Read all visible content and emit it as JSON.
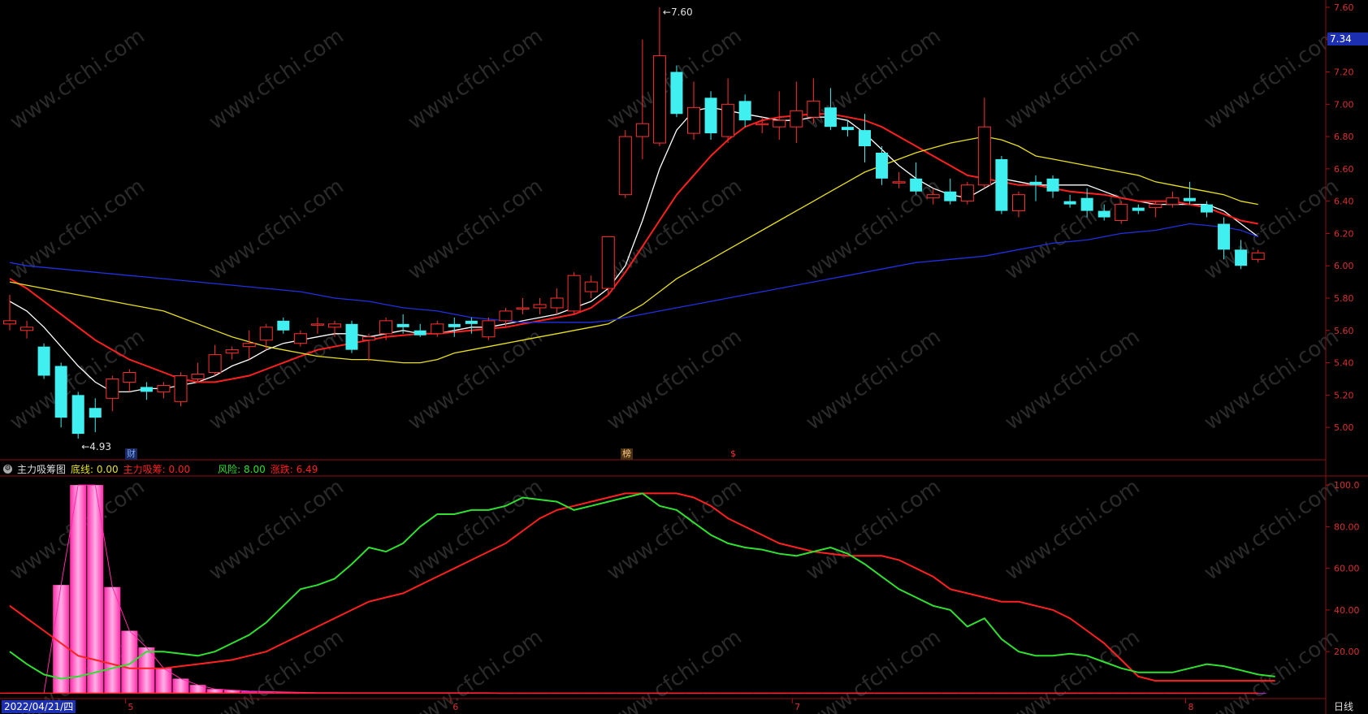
{
  "chart_data": [
    {
      "type": "candlestick",
      "panel": "price",
      "y_ticks": [
        "7.60",
        "7.40",
        "7.20",
        "7.00",
        "6.80",
        "6.60",
        "6.40",
        "6.20",
        "6.00",
        "5.80",
        "5.60",
        "5.40",
        "5.20",
        "5.00"
      ],
      "ylim": [
        4.88,
        7.62
      ],
      "high_label": "7.60",
      "low_label": "4.93",
      "last_price": "7.34",
      "candles": [
        {
          "o": 5.64,
          "h": 5.82,
          "l": 5.6,
          "c": 5.66
        },
        {
          "o": 5.6,
          "h": 5.66,
          "l": 5.55,
          "c": 5.62
        },
        {
          "o": 5.5,
          "h": 5.52,
          "l": 5.3,
          "c": 5.32
        },
        {
          "o": 5.38,
          "h": 5.4,
          "l": 5.0,
          "c": 5.06
        },
        {
          "o": 5.2,
          "h": 5.22,
          "l": 4.93,
          "c": 4.96
        },
        {
          "o": 5.12,
          "h": 5.18,
          "l": 4.97,
          "c": 5.06
        },
        {
          "o": 5.18,
          "h": 5.32,
          "l": 5.1,
          "c": 5.3
        },
        {
          "o": 5.28,
          "h": 5.36,
          "l": 5.22,
          "c": 5.34
        },
        {
          "o": 5.25,
          "h": 5.28,
          "l": 5.17,
          "c": 5.22
        },
        {
          "o": 5.22,
          "h": 5.28,
          "l": 5.18,
          "c": 5.26
        },
        {
          "o": 5.16,
          "h": 5.34,
          "l": 5.13,
          "c": 5.32
        },
        {
          "o": 5.3,
          "h": 5.4,
          "l": 5.28,
          "c": 5.33
        },
        {
          "o": 5.34,
          "h": 5.51,
          "l": 5.32,
          "c": 5.45
        },
        {
          "o": 5.46,
          "h": 5.5,
          "l": 5.42,
          "c": 5.48
        },
        {
          "o": 5.5,
          "h": 5.6,
          "l": 5.42,
          "c": 5.52
        },
        {
          "o": 5.54,
          "h": 5.64,
          "l": 5.48,
          "c": 5.62
        },
        {
          "o": 5.66,
          "h": 5.68,
          "l": 5.58,
          "c": 5.6
        },
        {
          "o": 5.52,
          "h": 5.6,
          "l": 5.5,
          "c": 5.58
        },
        {
          "o": 5.64,
          "h": 5.68,
          "l": 5.58,
          "c": 5.64
        },
        {
          "o": 5.62,
          "h": 5.66,
          "l": 5.56,
          "c": 5.64
        },
        {
          "o": 5.64,
          "h": 5.66,
          "l": 5.46,
          "c": 5.48
        },
        {
          "o": 5.54,
          "h": 5.58,
          "l": 5.41,
          "c": 5.56
        },
        {
          "o": 5.58,
          "h": 5.68,
          "l": 5.54,
          "c": 5.66
        },
        {
          "o": 5.64,
          "h": 5.7,
          "l": 5.58,
          "c": 5.62
        },
        {
          "o": 5.6,
          "h": 5.64,
          "l": 5.56,
          "c": 5.57
        },
        {
          "o": 5.58,
          "h": 5.66,
          "l": 5.56,
          "c": 5.64
        },
        {
          "o": 5.64,
          "h": 5.68,
          "l": 5.56,
          "c": 5.62
        },
        {
          "o": 5.66,
          "h": 5.68,
          "l": 5.58,
          "c": 5.64
        },
        {
          "o": 5.56,
          "h": 5.68,
          "l": 5.54,
          "c": 5.66
        },
        {
          "o": 5.66,
          "h": 5.74,
          "l": 5.62,
          "c": 5.72
        },
        {
          "o": 5.74,
          "h": 5.8,
          "l": 5.7,
          "c": 5.74
        },
        {
          "o": 5.74,
          "h": 5.8,
          "l": 5.7,
          "c": 5.76
        },
        {
          "o": 5.74,
          "h": 5.86,
          "l": 5.7,
          "c": 5.8
        },
        {
          "o": 5.72,
          "h": 5.96,
          "l": 5.7,
          "c": 5.94
        },
        {
          "o": 5.84,
          "h": 5.94,
          "l": 5.8,
          "c": 5.9
        },
        {
          "o": 5.86,
          "h": 6.18,
          "l": 5.82,
          "c": 6.18
        },
        {
          "o": 6.44,
          "h": 6.84,
          "l": 6.42,
          "c": 6.8
        },
        {
          "o": 6.8,
          "h": 7.4,
          "l": 6.66,
          "c": 6.88
        },
        {
          "o": 6.76,
          "h": 7.6,
          "l": 6.74,
          "c": 7.3
        },
        {
          "o": 7.2,
          "h": 7.24,
          "l": 6.92,
          "c": 6.94
        },
        {
          "o": 6.82,
          "h": 7.14,
          "l": 6.78,
          "c": 6.98
        },
        {
          "o": 7.04,
          "h": 7.08,
          "l": 6.78,
          "c": 6.82
        },
        {
          "o": 6.8,
          "h": 7.16,
          "l": 6.76,
          "c": 7.0
        },
        {
          "o": 7.02,
          "h": 7.06,
          "l": 6.86,
          "c": 6.9
        },
        {
          "o": 6.88,
          "h": 6.92,
          "l": 6.82,
          "c": 6.88
        },
        {
          "o": 6.86,
          "h": 7.08,
          "l": 6.78,
          "c": 6.9
        },
        {
          "o": 6.86,
          "h": 7.14,
          "l": 6.76,
          "c": 6.96
        },
        {
          "o": 6.92,
          "h": 7.16,
          "l": 6.88,
          "c": 7.02
        },
        {
          "o": 6.98,
          "h": 7.1,
          "l": 6.84,
          "c": 6.86
        },
        {
          "o": 6.86,
          "h": 6.9,
          "l": 6.8,
          "c": 6.84
        },
        {
          "o": 6.84,
          "h": 6.94,
          "l": 6.64,
          "c": 6.74
        },
        {
          "o": 6.7,
          "h": 6.74,
          "l": 6.5,
          "c": 6.54
        },
        {
          "o": 6.52,
          "h": 6.58,
          "l": 6.48,
          "c": 6.52
        },
        {
          "o": 6.54,
          "h": 6.64,
          "l": 6.44,
          "c": 6.46
        },
        {
          "o": 6.42,
          "h": 6.48,
          "l": 6.38,
          "c": 6.44
        },
        {
          "o": 6.46,
          "h": 6.54,
          "l": 6.38,
          "c": 6.4
        },
        {
          "o": 6.4,
          "h": 6.52,
          "l": 6.38,
          "c": 6.5
        },
        {
          "o": 6.5,
          "h": 7.04,
          "l": 6.48,
          "c": 6.86
        },
        {
          "o": 6.66,
          "h": 6.68,
          "l": 6.32,
          "c": 6.34
        },
        {
          "o": 6.34,
          "h": 6.46,
          "l": 6.3,
          "c": 6.44
        },
        {
          "o": 6.52,
          "h": 6.56,
          "l": 6.4,
          "c": 6.5
        },
        {
          "o": 6.54,
          "h": 6.56,
          "l": 6.42,
          "c": 6.46
        },
        {
          "o": 6.4,
          "h": 6.44,
          "l": 6.36,
          "c": 6.38
        },
        {
          "o": 6.42,
          "h": 6.48,
          "l": 6.3,
          "c": 6.34
        },
        {
          "o": 6.34,
          "h": 6.38,
          "l": 6.28,
          "c": 6.3
        },
        {
          "o": 6.28,
          "h": 6.4,
          "l": 6.26,
          "c": 6.38
        },
        {
          "o": 6.36,
          "h": 6.38,
          "l": 6.32,
          "c": 6.34
        },
        {
          "o": 6.36,
          "h": 6.4,
          "l": 6.3,
          "c": 6.38
        },
        {
          "o": 6.38,
          "h": 6.46,
          "l": 6.36,
          "c": 6.42
        },
        {
          "o": 6.42,
          "h": 6.52,
          "l": 6.38,
          "c": 6.4
        },
        {
          "o": 6.38,
          "h": 6.4,
          "l": 6.3,
          "c": 6.33
        },
        {
          "o": 6.26,
          "h": 6.3,
          "l": 6.04,
          "c": 6.1
        },
        {
          "o": 6.1,
          "h": 6.16,
          "l": 5.98,
          "c": 6.0
        },
        {
          "o": 6.04,
          "h": 6.1,
          "l": 6.02,
          "c": 6.08
        }
      ],
      "ma": [
        {
          "color": "#ffffff",
          "values": [
            5.78,
            5.72,
            5.62,
            5.5,
            5.38,
            5.28,
            5.22,
            5.22,
            5.24,
            5.24,
            5.26,
            5.28,
            5.32,
            5.38,
            5.42,
            5.48,
            5.52,
            5.54,
            5.56,
            5.58,
            5.58,
            5.56,
            5.58,
            5.6,
            5.58,
            5.58,
            5.6,
            5.62,
            5.62,
            5.64,
            5.66,
            5.68,
            5.7,
            5.74,
            5.78,
            5.86,
            6.0,
            6.28,
            6.6,
            6.84,
            6.96,
            6.98,
            6.96,
            6.94,
            6.92,
            6.9,
            6.9,
            6.92,
            6.92,
            6.9,
            6.82,
            6.72,
            6.62,
            6.54,
            6.48,
            6.44,
            6.42,
            6.48,
            6.54,
            6.52,
            6.5,
            6.5,
            6.5,
            6.5,
            6.46,
            6.42,
            6.4,
            6.38,
            6.38,
            6.38,
            6.38,
            6.34,
            6.26,
            6.18
          ]
        },
        {
          "color": "#ff2020",
          "values": [
            5.92,
            5.86,
            5.78,
            5.7,
            5.62,
            5.54,
            5.48,
            5.42,
            5.38,
            5.34,
            5.3,
            5.28,
            5.28,
            5.3,
            5.32,
            5.36,
            5.4,
            5.44,
            5.48,
            5.5,
            5.52,
            5.54,
            5.56,
            5.57,
            5.58,
            5.58,
            5.59,
            5.6,
            5.61,
            5.62,
            5.64,
            5.66,
            5.68,
            5.7,
            5.74,
            5.82,
            5.96,
            6.12,
            6.28,
            6.44,
            6.56,
            6.68,
            6.78,
            6.86,
            6.9,
            6.92,
            6.93,
            6.94,
            6.94,
            6.92,
            6.9,
            6.86,
            6.8,
            6.74,
            6.68,
            6.62,
            6.56,
            6.54,
            6.52,
            6.5,
            6.5,
            6.48,
            6.46,
            6.45,
            6.44,
            6.42,
            6.4,
            6.4,
            6.4,
            6.38,
            6.36,
            6.32,
            6.28,
            6.26
          ]
        },
        {
          "color": "#e8e020",
          "values": [
            5.9,
            5.88,
            5.86,
            5.84,
            5.82,
            5.8,
            5.78,
            5.76,
            5.74,
            5.72,
            5.68,
            5.64,
            5.6,
            5.56,
            5.53,
            5.5,
            5.48,
            5.46,
            5.44,
            5.43,
            5.42,
            5.42,
            5.41,
            5.4,
            5.4,
            5.42,
            5.46,
            5.48,
            5.5,
            5.52,
            5.54,
            5.56,
            5.58,
            5.6,
            5.62,
            5.64,
            5.7,
            5.76,
            5.84,
            5.92,
            5.98,
            6.04,
            6.1,
            6.16,
            6.22,
            6.28,
            6.34,
            6.4,
            6.46,
            6.52,
            6.58,
            6.62,
            6.66,
            6.7,
            6.73,
            6.76,
            6.78,
            6.8,
            6.78,
            6.74,
            6.68,
            6.66,
            6.64,
            6.62,
            6.6,
            6.58,
            6.56,
            6.52,
            6.5,
            6.48,
            6.46,
            6.44,
            6.4,
            6.38
          ]
        },
        {
          "color": "#2030e0",
          "values": [
            6.02,
            6.0,
            5.99,
            5.98,
            5.97,
            5.96,
            5.95,
            5.94,
            5.93,
            5.92,
            5.91,
            5.9,
            5.89,
            5.88,
            5.87,
            5.86,
            5.85,
            5.84,
            5.82,
            5.8,
            5.79,
            5.78,
            5.76,
            5.74,
            5.73,
            5.72,
            5.7,
            5.68,
            5.67,
            5.66,
            5.65,
            5.65,
            5.65,
            5.65,
            5.65,
            5.66,
            5.68,
            5.7,
            5.72,
            5.74,
            5.76,
            5.78,
            5.8,
            5.82,
            5.84,
            5.86,
            5.88,
            5.9,
            5.92,
            5.94,
            5.96,
            5.98,
            6.0,
            6.02,
            6.03,
            6.04,
            6.05,
            6.06,
            6.08,
            6.1,
            6.12,
            6.14,
            6.15,
            6.16,
            6.18,
            6.2,
            6.21,
            6.22,
            6.24,
            6.26,
            6.25,
            6.24,
            6.22,
            6.18
          ]
        }
      ],
      "events": [
        {
          "label": "财",
          "index": 7,
          "color": "#7aa8ff"
        },
        {
          "label": "榜",
          "index": 35,
          "color": "#ffcc88"
        },
        {
          "label": "$",
          "index": 41,
          "color": "#ff3030"
        }
      ]
    },
    {
      "type": "line",
      "panel": "indicator",
      "title": "主力吸筹图",
      "legend": [
        {
          "label": "底线: 0.00",
          "color": "#e8e020"
        },
        {
          "label": "主力吸筹: 0.00",
          "color": "#ff2020"
        },
        {
          "label": "风险: 8.00",
          "color": "#30e030"
        },
        {
          "label": "涨跌: 6.49",
          "color": "#ff2020"
        }
      ],
      "y_ticks": [
        "100.0",
        "80.00",
        "60.00",
        "40.00",
        "20.00"
      ],
      "ylim": [
        -1,
        102
      ],
      "risk": [
        20,
        14,
        9,
        7,
        8,
        10,
        12,
        14,
        20,
        20,
        19,
        18,
        20,
        24,
        28,
        34,
        42,
        50,
        52,
        55,
        62,
        70,
        68,
        72,
        80,
        86,
        86,
        88,
        88,
        90,
        94,
        93,
        92,
        88,
        90,
        92,
        94,
        96,
        90,
        88,
        82,
        76,
        72,
        70,
        69,
        67,
        66,
        68,
        70,
        67,
        62,
        56,
        50,
        46,
        42,
        40,
        32,
        36,
        26,
        20,
        18,
        18,
        19,
        18,
        15,
        12,
        10,
        10,
        10,
        12,
        14,
        13,
        11,
        9,
        8
      ],
      "ups": [
        42,
        36,
        30,
        24,
        18,
        16,
        14,
        12,
        12,
        12,
        13,
        14,
        15,
        16,
        18,
        20,
        24,
        28,
        32,
        36,
        40,
        44,
        46,
        48,
        52,
        56,
        60,
        64,
        68,
        72,
        78,
        84,
        88,
        90,
        92,
        94,
        96,
        96,
        96,
        96,
        94,
        90,
        84,
        80,
        76,
        72,
        70,
        68,
        67,
        66,
        66,
        66,
        64,
        60,
        56,
        50,
        48,
        46,
        44,
        44,
        42,
        40,
        36,
        30,
        24,
        16,
        8,
        6,
        6,
        6,
        6,
        6,
        6,
        6,
        6
      ],
      "bars": [
        0,
        0,
        0,
        52,
        100,
        100,
        51,
        30,
        22,
        12,
        7,
        4,
        2,
        1.5,
        1,
        0.8,
        0.6,
        0.4,
        0.3,
        0.3,
        0.2,
        0.2,
        0.2,
        0.2,
        0.2,
        0.2,
        0.2,
        0.2,
        0.2,
        0.1,
        0.1,
        0.1,
        0.1,
        0.1,
        0.1,
        0.1,
        0.1,
        0.1,
        0.1,
        0.1,
        0.1,
        0.1,
        0.1,
        0.1,
        0.1,
        0.1,
        0.1,
        0.1,
        0.1,
        0.1,
        0.1,
        0.1,
        0.1,
        0.1,
        0.1,
        0.1,
        0.1,
        0.1,
        0.1,
        0.1,
        0.1,
        0.1,
        0.1,
        0.1,
        0.1,
        0.1,
        0.1,
        0.1,
        0.1,
        0.1,
        0.1,
        0.1,
        0.1,
        0.1
      ]
    }
  ],
  "x_axis": {
    "start_date": "2022/04/21/四",
    "month_marks": [
      {
        "label": "5",
        "index": 7
      },
      {
        "label": "6",
        "index": 26
      },
      {
        "label": "7",
        "index": 46
      },
      {
        "label": "8",
        "index": 69
      }
    ]
  },
  "period_label": "日线",
  "watermark": "www.cfchi.com"
}
